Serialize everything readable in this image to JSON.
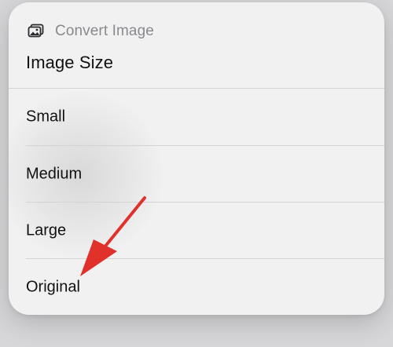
{
  "menu": {
    "app_icon": "photos-icon",
    "app_name": "Convert Image",
    "title": "Image Size",
    "options": [
      {
        "label": "Small"
      },
      {
        "label": "Medium"
      },
      {
        "label": "Large"
      },
      {
        "label": "Original"
      }
    ]
  },
  "annotation": {
    "arrow_icon": "red-arrow-icon",
    "arrow_color": "#e0312b",
    "points_to": "Original"
  }
}
